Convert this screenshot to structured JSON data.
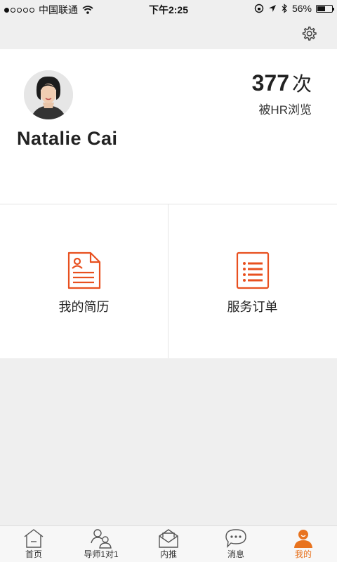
{
  "status_bar": {
    "carrier": "中国联通",
    "time": "下午2:25",
    "battery": "56%"
  },
  "profile": {
    "name": "Natalie Cai",
    "views_count": "377",
    "views_unit": "次",
    "views_label": "被HR浏览"
  },
  "grid": {
    "items": [
      {
        "label": "我的简历",
        "icon": "resume-icon"
      },
      {
        "label": "服务订单",
        "icon": "order-list-icon"
      }
    ]
  },
  "tabbar": {
    "tabs": [
      {
        "label": "首页",
        "icon": "home-icon"
      },
      {
        "label": "导师1对1",
        "icon": "mentor-icon"
      },
      {
        "label": "内推",
        "icon": "envelope-icon"
      },
      {
        "label": "消息",
        "icon": "chat-bubble-icon"
      },
      {
        "label": "我的",
        "icon": "profile-icon"
      }
    ],
    "active_index": 4
  },
  "colors": {
    "accent": "#e8731f",
    "icon_orange": "#e8501f"
  }
}
